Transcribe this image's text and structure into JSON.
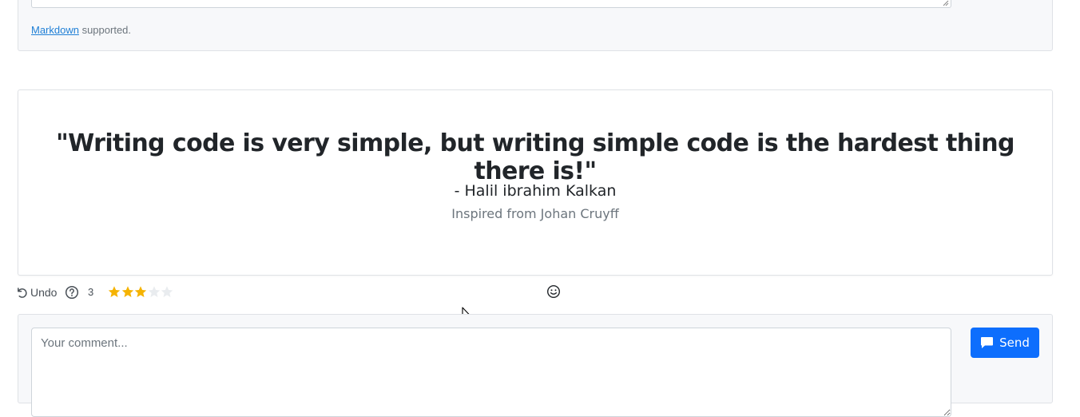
{
  "top_comment": {
    "markdown_link": "Markdown",
    "markdown_suffix": " supported."
  },
  "quote": {
    "text": "\"Writing code is very simple, but writing simple code is the hardest thing there is!\"",
    "author": "- Halil ibrahim Kalkan",
    "source": "Inspired from Johan Cruyff"
  },
  "toolbar": {
    "undo_label": "Undo",
    "rating_value": "3",
    "rating": 3,
    "rating_max": 5,
    "icons": [
      "undo-icon",
      "help-icon",
      "star-icon",
      "smile-icon"
    ]
  },
  "comment_form": {
    "placeholder": "Your comment...",
    "value": "",
    "send_label": "Send",
    "send_icon": "comment-icon"
  },
  "colors": {
    "accent": "#0d6efd",
    "star_filled": "#f5b301",
    "star_empty": "#e9ecef",
    "card_background": "#f7f8fa",
    "link": "#1f7fd6"
  }
}
